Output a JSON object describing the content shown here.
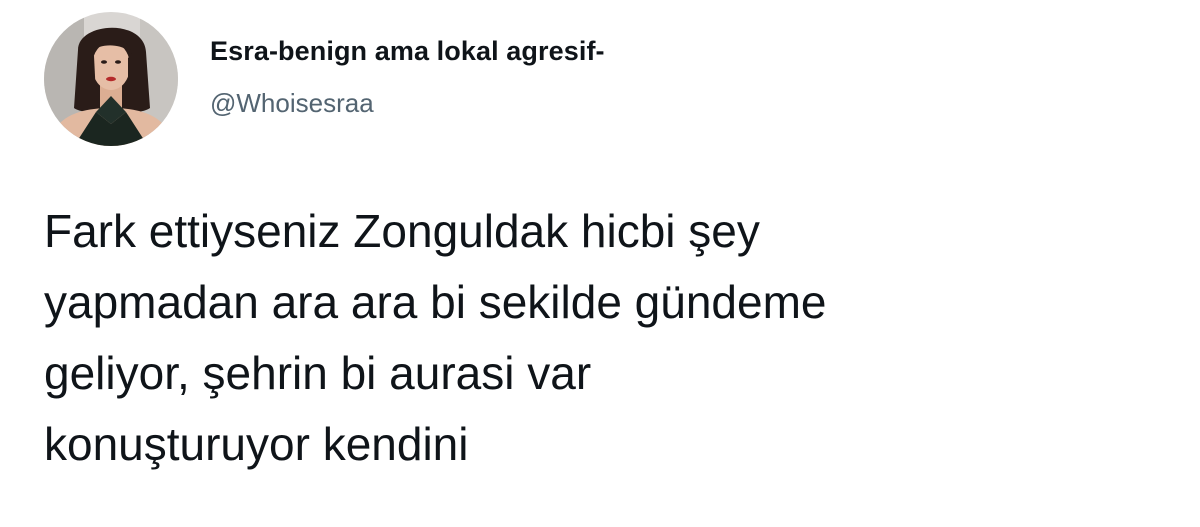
{
  "tweet": {
    "author": {
      "display_name": "Esra-benign ama lokal agresif-",
      "handle": "@Whoisesraa",
      "avatar": "profile-photo"
    },
    "text_lines": [
      "Fark ettiyseniz Zonguldak hicbi şey",
      "yapmadan ara ara bi sekilde gündeme",
      "geliyor, şehrin bi aurasi var",
      "konuşturuyor kendini"
    ]
  },
  "colors": {
    "text_primary": "#0f1419",
    "text_secondary": "#536471",
    "background": "#ffffff"
  }
}
